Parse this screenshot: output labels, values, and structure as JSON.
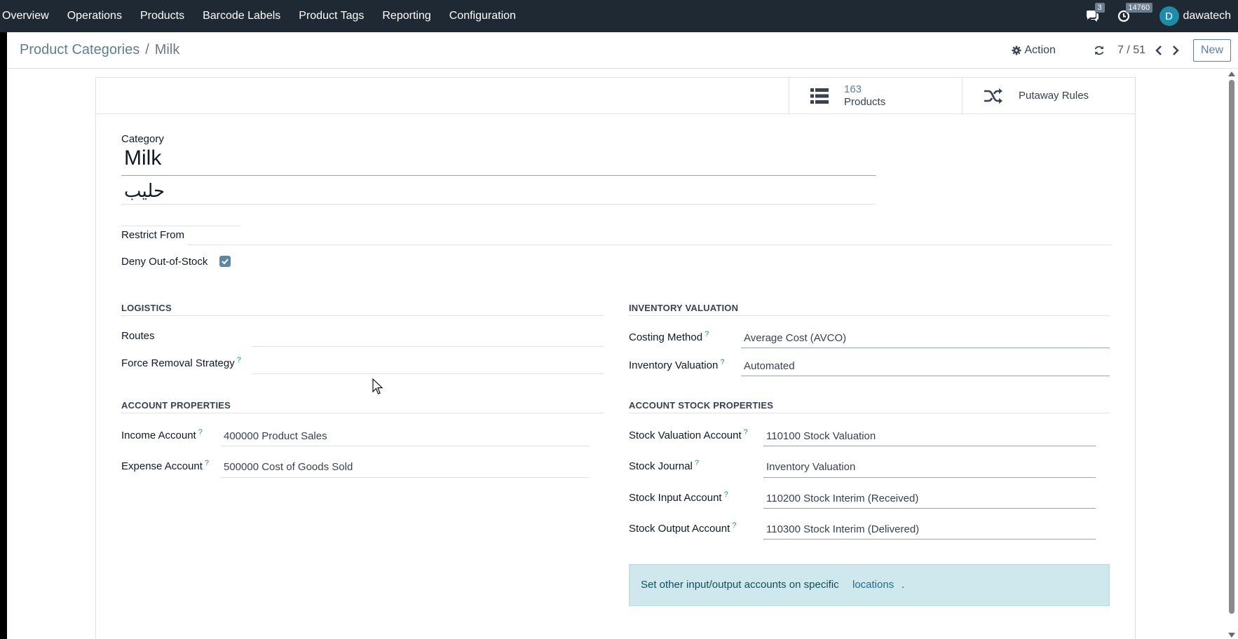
{
  "navbar": {
    "menu": [
      "Overview",
      "Operations",
      "Products",
      "Barcode Labels",
      "Product Tags",
      "Reporting",
      "Configuration"
    ],
    "messages_count": "3",
    "activity_count": "14760",
    "user_initial": "D",
    "user_name": "dawatech"
  },
  "control_panel": {
    "breadcrumb_parent": "Product Categories",
    "breadcrumb_separator": "/",
    "breadcrumb_current": "Milk",
    "action_label": "Action",
    "pager": "7 / 51",
    "new_label": "New"
  },
  "button_box": {
    "products_count": "163",
    "products_label": "Products",
    "putaway_label": "Putaway Rules"
  },
  "form": {
    "category_label": "Category",
    "name": "Milk",
    "name_arabic": "حليب",
    "restrict_from_label": "Restrict From",
    "restrict_from_value": "",
    "deny_out_of_stock_label": "Deny Out-of-Stock",
    "deny_out_of_stock": true,
    "logistics": {
      "title": "LOGISTICS",
      "routes_label": "Routes",
      "routes_value": "",
      "removal_label": "Force Removal Strategy",
      "removal_value": ""
    },
    "inventory_valuation": {
      "title": "INVENTORY VALUATION",
      "costing_label": "Costing Method",
      "costing_value": "Average Cost (AVCO)",
      "valuation_label": "Inventory Valuation",
      "valuation_value": "Automated"
    },
    "account_properties": {
      "title": "ACCOUNT PROPERTIES",
      "income_label": "Income Account",
      "income_value": "400000 Product Sales",
      "expense_label": "Expense Account",
      "expense_value": "500000 Cost of Goods Sold"
    },
    "account_stock_properties": {
      "title": "ACCOUNT STOCK PROPERTIES",
      "valuation_account_label": "Stock Valuation Account",
      "valuation_account_value": "110100 Stock Valuation",
      "journal_label": "Stock Journal",
      "journal_value": "Inventory Valuation",
      "input_label": "Stock Input Account",
      "input_value": "110200 Stock Interim (Received)",
      "output_label": "Stock Output Account",
      "output_value": "110300 Stock Interim (Delivered)"
    },
    "alert": {
      "text": "Set other input/output accounts on specific",
      "link": "locations",
      "suffix": "."
    },
    "help_marker": "?"
  },
  "colors": {
    "navbar_bg": "#1f2933",
    "accent": "#5f7d95",
    "help": "#1d8ca8",
    "alert_bg": "#cfe8ee"
  }
}
